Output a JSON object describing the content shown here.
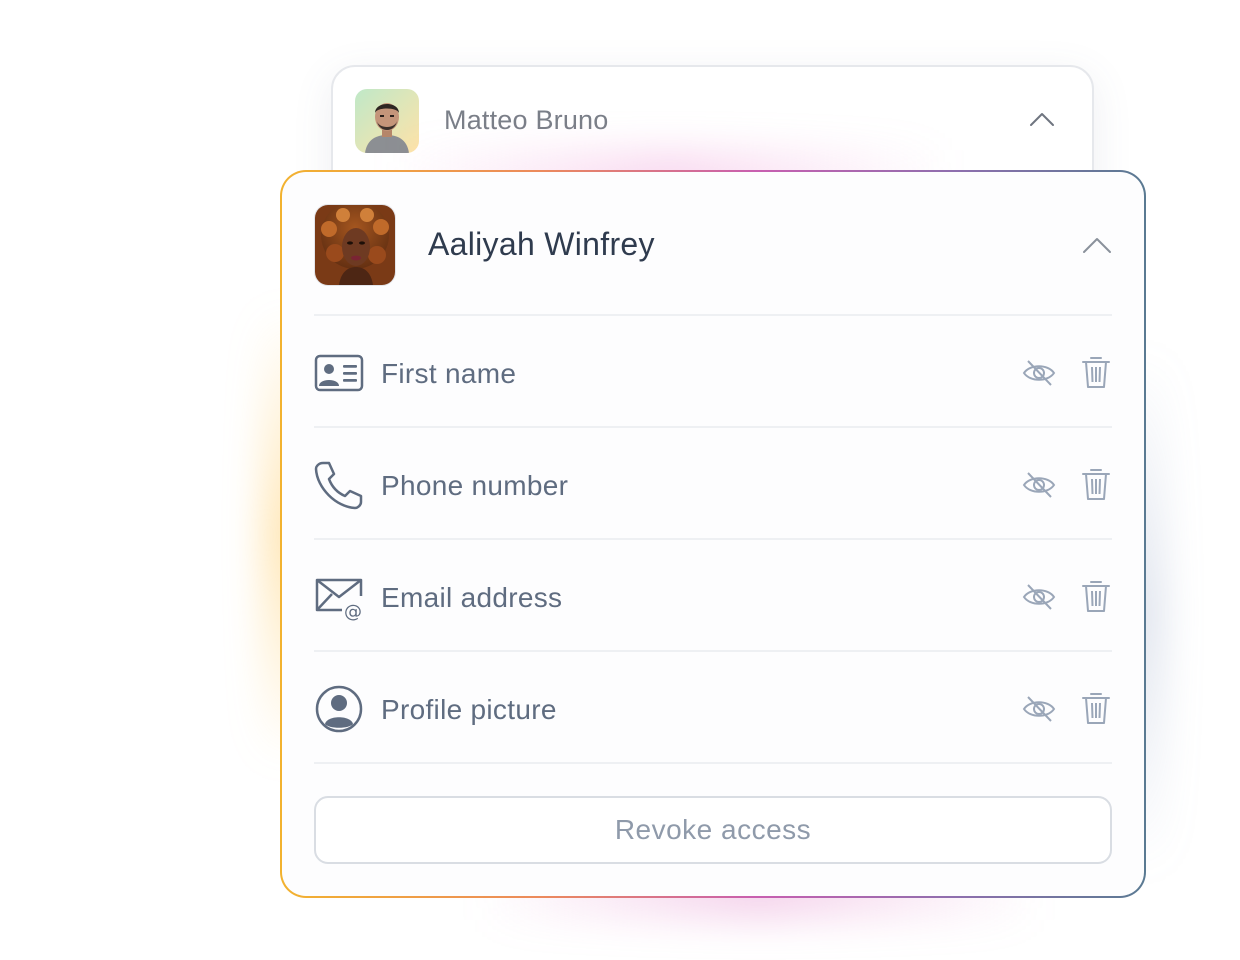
{
  "back_contact": {
    "name": "Matteo Bruno",
    "avatar": "person-photo-avatar",
    "toggle_icon": "chevron-up-icon"
  },
  "front_contact": {
    "name": "Aaliyah Winfrey",
    "avatar": "person-photo-avatar",
    "toggle_icon": "chevron-up-icon",
    "fields": [
      {
        "label": "First name",
        "icon": "id-card-icon"
      },
      {
        "label": "Phone number",
        "icon": "phone-icon"
      },
      {
        "label": "Email address",
        "icon": "email-at-icon"
      },
      {
        "label": "Profile picture",
        "icon": "user-circle-icon"
      }
    ],
    "field_actions": [
      "eye-off-icon",
      "trash-icon"
    ],
    "revoke_label": "Revoke access"
  },
  "colors": {
    "border_gradient": [
      "#f2b22f",
      "#c85fb0",
      "#5a7a92"
    ],
    "name_text": "#2f3b4e",
    "field_text": "#5f6c80",
    "action_icon": "#9aa6b8",
    "button_text": "#8f9aaa"
  }
}
